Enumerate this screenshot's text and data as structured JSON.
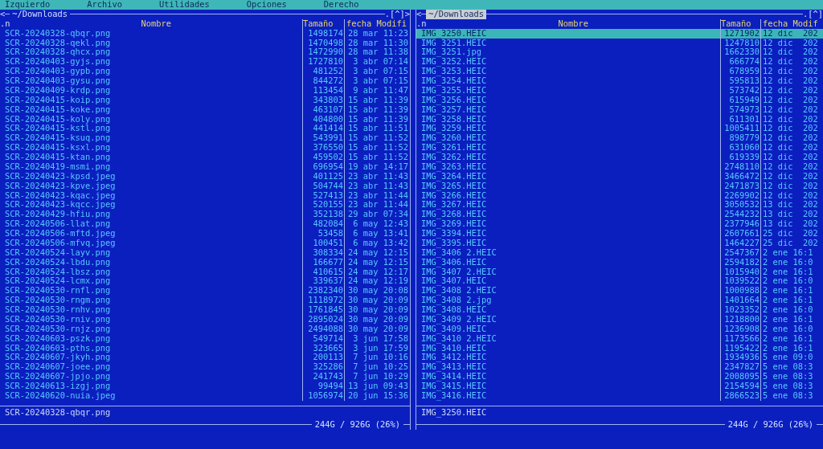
{
  "menu": [
    "Izquierdo",
    "Archivo",
    "Utilidades",
    "Opciones",
    "Derecho"
  ],
  "panels": [
    {
      "active": false,
      "back": "<",
      "path": "~/Downloads",
      "corner": ".[^]>",
      "sort": ".n",
      "columns": [
        "Nombre",
        "Tamaño",
        "fecha Modifi"
      ],
      "rows": [
        {
          "name": "SCR-20240328-qbqr.png",
          "size": "1498174",
          "date": "28 mar 11:23",
          "selected": false
        },
        {
          "name": "SCR-20240328-qekl.png",
          "size": "1470498",
          "date": "28 mar 11:30",
          "selected": false
        },
        {
          "name": "SCR-20240328-qhcx.png",
          "size": "1472990",
          "date": "28 mar 11:38",
          "selected": false
        },
        {
          "name": "SCR-20240403-gyjs.png",
          "size": "1727810",
          "date": "3 abr 07:14",
          "selected": false
        },
        {
          "name": "SCR-20240403-gypb.png",
          "size": "481252",
          "date": "3 abr 07:15",
          "selected": false
        },
        {
          "name": "SCR-20240403-gysu.png",
          "size": "844272",
          "date": "3 abr 07:15",
          "selected": false
        },
        {
          "name": "SCR-20240409-krdp.png",
          "size": "113454",
          "date": "9 abr 11:47",
          "selected": false
        },
        {
          "name": "SCR-20240415-koip.png",
          "size": "343803",
          "date": "15 abr 11:39",
          "selected": false
        },
        {
          "name": "SCR-20240415-koke.png",
          "size": "463107",
          "date": "15 abr 11:39",
          "selected": false
        },
        {
          "name": "SCR-20240415-koly.png",
          "size": "404800",
          "date": "15 abr 11:39",
          "selected": false
        },
        {
          "name": "SCR-20240415-kstl.png",
          "size": "441414",
          "date": "15 abr 11:51",
          "selected": false
        },
        {
          "name": "SCR-20240415-ksuq.png",
          "size": "543991",
          "date": "15 abr 11:52",
          "selected": false
        },
        {
          "name": "SCR-20240415-ksxl.png",
          "size": "376550",
          "date": "15 abr 11:52",
          "selected": false
        },
        {
          "name": "SCR-20240415-ktan.png",
          "size": "459502",
          "date": "15 abr 11:52",
          "selected": false
        },
        {
          "name": "SCR-20240419-msmi.png",
          "size": "696954",
          "date": "19 abr 14:17",
          "selected": false
        },
        {
          "name": "SCR-20240423-kpsd.jpeg",
          "size": "401125",
          "date": "23 abr 11:43",
          "selected": false
        },
        {
          "name": "SCR-20240423-kpve.jpeg",
          "size": "504744",
          "date": "23 abr 11:43",
          "selected": false
        },
        {
          "name": "SCR-20240423-kqac.jpeg",
          "size": "527413",
          "date": "23 abr 11:44",
          "selected": false
        },
        {
          "name": "SCR-20240423-kqcc.jpeg",
          "size": "520155",
          "date": "23 abr 11:44",
          "selected": false
        },
        {
          "name": "SCR-20240429-hfiu.png",
          "size": "352138",
          "date": "29 abr 07:34",
          "selected": false
        },
        {
          "name": "SCR-20240506-llat.png",
          "size": "482084",
          "date": "6 may 12:43",
          "selected": false
        },
        {
          "name": "SCR-20240506-mftd.jpeg",
          "size": "53458",
          "date": "6 may 13:41",
          "selected": false
        },
        {
          "name": "SCR-20240506-mfvq.jpeg",
          "size": "100451",
          "date": "6 may 13:42",
          "selected": false
        },
        {
          "name": "SCR-20240524-layv.png",
          "size": "308334",
          "date": "24 may 12:15",
          "selected": false
        },
        {
          "name": "SCR-20240524-lbdu.png",
          "size": "166677",
          "date": "24 may 12:15",
          "selected": false
        },
        {
          "name": "SCR-20240524-lbsz.png",
          "size": "410615",
          "date": "24 may 12:17",
          "selected": false
        },
        {
          "name": "SCR-20240524-lcmx.png",
          "size": "339637",
          "date": "24 may 12:19",
          "selected": false
        },
        {
          "name": "SCR-20240530-rnfl.png",
          "size": "2382340",
          "date": "30 may 20:08",
          "selected": false
        },
        {
          "name": "SCR-20240530-rngm.png",
          "size": "1118972",
          "date": "30 may 20:09",
          "selected": false
        },
        {
          "name": "SCR-20240530-rnhv.png",
          "size": "1761845",
          "date": "30 may 20:09",
          "selected": false
        },
        {
          "name": "SCR-20240530-rniv.png",
          "size": "2895024",
          "date": "30 may 20:09",
          "selected": false
        },
        {
          "name": "SCR-20240530-rnjz.png",
          "size": "2494088",
          "date": "30 may 20:09",
          "selected": false
        },
        {
          "name": "SCR-20240603-pszk.png",
          "size": "549714",
          "date": "3 jun 17:58",
          "selected": false
        },
        {
          "name": "SCR-20240603-pths.png",
          "size": "323665",
          "date": "3 jun 17:59",
          "selected": false
        },
        {
          "name": "SCR-20240607-jkyh.png",
          "size": "200113",
          "date": "7 jun 10:16",
          "selected": false
        },
        {
          "name": "SCR-20240607-joee.png",
          "size": "325286",
          "date": "7 jun 10:25",
          "selected": false
        },
        {
          "name": "SCR-20240607-jpjo.png",
          "size": "241743",
          "date": "7 jun 10:29",
          "selected": false
        },
        {
          "name": "SCR-20240613-izgj.png",
          "size": "99494",
          "date": "13 jun 09:43",
          "selected": false
        },
        {
          "name": "SCR-20240620-nuia.jpeg",
          "size": "1056974",
          "date": "20 jun 15:36",
          "selected": false
        }
      ],
      "status": "SCR-20240328-qbqr.png",
      "disk": "244G / 926G (26%)"
    },
    {
      "active": true,
      "back": "<",
      "path": "~/Downloads",
      "corner": ".[^]",
      "sort": ".n",
      "columns": [
        "Nombre",
        "Tamaño",
        "fecha Modif"
      ],
      "rows": [
        {
          "name": "IMG_3250.HEIC",
          "size": "1271902",
          "date": "12 dic  202",
          "selected": true
        },
        {
          "name": "IMG_3251.HEIC",
          "size": "1247810",
          "date": "12 dic  202",
          "selected": false
        },
        {
          "name": "IMG_3251.jpg",
          "size": "1662330",
          "date": "12 dic  202",
          "selected": false
        },
        {
          "name": "IMG_3252.HEIC",
          "size": "666774",
          "date": "12 dic  202",
          "selected": false
        },
        {
          "name": "IMG_3253.HEIC",
          "size": "678959",
          "date": "12 dic  202",
          "selected": false
        },
        {
          "name": "IMG_3254.HEIC",
          "size": "595813",
          "date": "12 dic  202",
          "selected": false
        },
        {
          "name": "IMG_3255.HEIC",
          "size": "573742",
          "date": "12 dic  202",
          "selected": false
        },
        {
          "name": "IMG_3256.HEIC",
          "size": "615949",
          "date": "12 dic  202",
          "selected": false
        },
        {
          "name": "IMG_3257.HEIC",
          "size": "574973",
          "date": "12 dic  202",
          "selected": false
        },
        {
          "name": "IMG_3258.HEIC",
          "size": "611301",
          "date": "12 dic  202",
          "selected": false
        },
        {
          "name": "IMG_3259.HEIC",
          "size": "1005411",
          "date": "12 dic  202",
          "selected": false
        },
        {
          "name": "IMG_3260.HEIC",
          "size": "898779",
          "date": "12 dic  202",
          "selected": false
        },
        {
          "name": "IMG_3261.HEIC",
          "size": "631060",
          "date": "12 dic  202",
          "selected": false
        },
        {
          "name": "IMG_3262.HEIC",
          "size": "619339",
          "date": "12 dic  202",
          "selected": false
        },
        {
          "name": "IMG_3263.HEIC",
          "size": "2748110",
          "date": "12 dic  202",
          "selected": false
        },
        {
          "name": "IMG_3264.HEIC",
          "size": "3466472",
          "date": "12 dic  202",
          "selected": false
        },
        {
          "name": "IMG_3265.HEIC",
          "size": "2471873",
          "date": "12 dic  202",
          "selected": false
        },
        {
          "name": "IMG_3266.HEIC",
          "size": "2269902",
          "date": "12 dic  202",
          "selected": false
        },
        {
          "name": "IMG_3267.HEIC",
          "size": "3050532",
          "date": "13 dic  202",
          "selected": false
        },
        {
          "name": "IMG_3268.HEIC",
          "size": "2544232",
          "date": "13 dic  202",
          "selected": false
        },
        {
          "name": "IMG_3269.HEIC",
          "size": "2377946",
          "date": "13 dic  202",
          "selected": false
        },
        {
          "name": "IMG_3394.HEIC",
          "size": "2607661",
          "date": "25 dic  202",
          "selected": false
        },
        {
          "name": "IMG_3395.HEIC",
          "size": "1464227",
          "date": "25 dic  202",
          "selected": false
        },
        {
          "name": "IMG_3406 2.HEIC",
          "size": "2547367",
          "date": "2 ene 16:1",
          "selected": false
        },
        {
          "name": "IMG_3406.HEIC",
          "size": "2594182",
          "date": "2 ene 16:0",
          "selected": false
        },
        {
          "name": "IMG_3407 2.HEIC",
          "size": "1015940",
          "date": "2 ene 16:1",
          "selected": false
        },
        {
          "name": "IMG_3407.HEIC",
          "size": "1039522",
          "date": "2 ene 16:0",
          "selected": false
        },
        {
          "name": "IMG_3408 2.HEIC",
          "size": "1000988",
          "date": "2 ene 16:1",
          "selected": false
        },
        {
          "name": "IMG_3408 2.jpg",
          "size": "1401664",
          "date": "2 ene 16:1",
          "selected": false
        },
        {
          "name": "IMG_3408.HEIC",
          "size": "1023352",
          "date": "2 ene 16:0",
          "selected": false
        },
        {
          "name": "IMG_3409 2.HEIC",
          "size": "1218800",
          "date": "2 ene 16:1",
          "selected": false
        },
        {
          "name": "IMG_3409.HEIC",
          "size": "1236908",
          "date": "2 ene 16:0",
          "selected": false
        },
        {
          "name": "IMG_3410 2.HEIC",
          "size": "1173566",
          "date": "2 ene 16:1",
          "selected": false
        },
        {
          "name": "IMG_3410.HEIC",
          "size": "1195422",
          "date": "2 ene 16:1",
          "selected": false
        },
        {
          "name": "IMG_3412.HEIC",
          "size": "1934936",
          "date": "5 ene 09:0",
          "selected": false
        },
        {
          "name": "IMG_3413.HEIC",
          "size": "2347827",
          "date": "5 ene 08:3",
          "selected": false
        },
        {
          "name": "IMG_3414.HEIC",
          "size": "2008095",
          "date": "5 ene 08:3",
          "selected": false
        },
        {
          "name": "IMG_3415.HEIC",
          "size": "2154594",
          "date": "5 ene 08:3",
          "selected": false
        },
        {
          "name": "IMG_3416.HEIC",
          "size": "2866523",
          "date": "5 ene 08:3",
          "selected": false
        }
      ],
      "status": "IMG_3250.HEIC",
      "disk": "244G / 926G (26%)"
    }
  ]
}
